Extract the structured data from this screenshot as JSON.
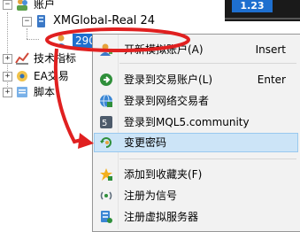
{
  "tree": {
    "accounts_label": "账户",
    "server_label": "XMGlobal-Real 24",
    "account_number": "290",
    "indicators_label": "技术指标",
    "ea_label": "EA交易",
    "scripts_label": "脚本"
  },
  "chart_thumb": {
    "value": "1.23"
  },
  "context_menu": {
    "items": [
      {
        "label": "开新模拟账户(A)",
        "shortcut": "Insert",
        "icon": "new-account-icon"
      },
      {
        "label": "登录到交易账户(L)",
        "shortcut": "Enter",
        "icon": "login-trade-icon"
      },
      {
        "label": "登录到网络交易者",
        "shortcut": "",
        "icon": "globe-login-icon"
      },
      {
        "label": "登录到MQL5.community",
        "shortcut": "",
        "icon": "mql5-login-icon"
      },
      {
        "label": "变更密码",
        "shortcut": "",
        "icon": "change-password-icon"
      },
      {
        "label": "添加到收藏夹(F)",
        "shortcut": "",
        "icon": "star-favorite-icon"
      },
      {
        "label": "注册为信号",
        "shortcut": "",
        "icon": "signal-icon"
      },
      {
        "label": "注册虚拟服务器",
        "shortcut": "",
        "icon": "virtual-server-icon"
      }
    ]
  },
  "colors": {
    "highlight": "#cce4f7",
    "annotation": "#e02020",
    "selected_node": "#1e6fcf"
  }
}
